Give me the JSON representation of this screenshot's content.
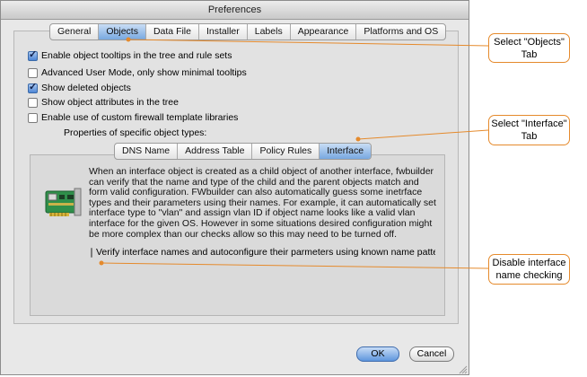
{
  "window": {
    "title": "Preferences"
  },
  "main_tabs": [
    {
      "label": "General",
      "selected": false
    },
    {
      "label": "Objects",
      "selected": true
    },
    {
      "label": "Data File",
      "selected": false
    },
    {
      "label": "Installer",
      "selected": false
    },
    {
      "label": "Labels",
      "selected": false
    },
    {
      "label": "Appearance",
      "selected": false
    },
    {
      "label": "Platforms and OS",
      "selected": false
    }
  ],
  "options": [
    {
      "label": "Enable object tooltips in the tree and rule sets",
      "checked": true
    },
    {
      "label": "Advanced User Mode, only show minimal tooltips",
      "checked": false
    },
    {
      "label": "Show deleted objects",
      "checked": true
    },
    {
      "label": "Show object attributes in the tree",
      "checked": false
    },
    {
      "label": "Enable use of custom firewall template libraries",
      "checked": false
    }
  ],
  "object_types_label": "Properties of specific object types:",
  "object_tabs": [
    {
      "label": "DNS Name",
      "selected": false
    },
    {
      "label": "Address Table",
      "selected": false
    },
    {
      "label": "Policy Rules",
      "selected": false
    },
    {
      "label": "Interface",
      "selected": true
    }
  ],
  "interface_panel": {
    "description": "When an interface object is created as a child object of another interface, fwbuilder can verify that the name and type of the child and the parent objects match and form valid configuration. FWbuilder can also automatically guess some inetrface types and their parameters using their names. For example, it can automatically set interface type to \"vlan\" and assign vlan ID if object name looks like a valid vlan interface for the given OS. However in some situations desired configuration might be more complex than our checks allow so this may need to be turned off.",
    "verify_label": "Verify interface names and autoconfigure their parmeters using known name patte",
    "verify_checked": false,
    "icon": "network-card-icon"
  },
  "buttons": {
    "ok": "OK",
    "cancel": "Cancel"
  },
  "callouts": {
    "objects": "Select \"Objects\" Tab",
    "interface": "Select \"Interface\" Tab",
    "disable": "Disable interface name checking"
  },
  "colors": {
    "callout_border": "#e58a2c",
    "selected_tab": "#78a8e0"
  }
}
